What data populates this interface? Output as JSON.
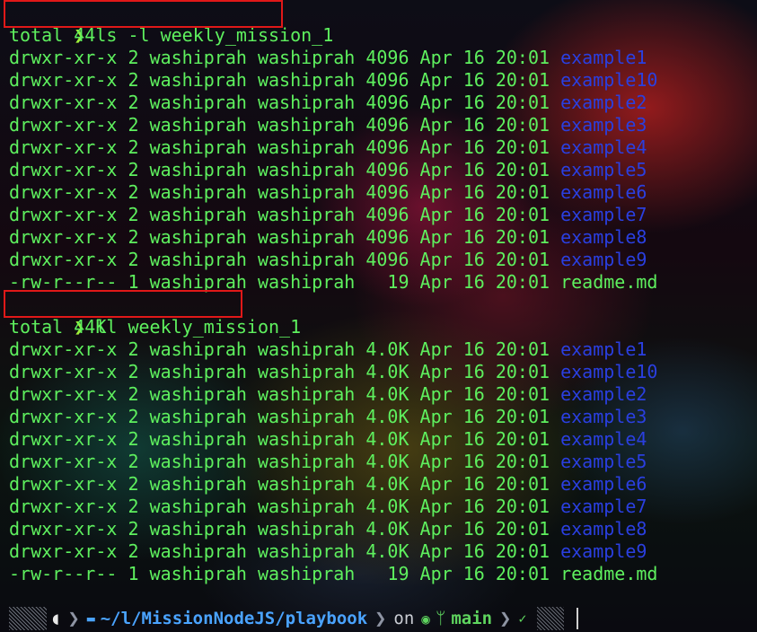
{
  "terminal": {
    "prompt_symbol": "❯",
    "command_1": "ls -l weekly_mission_1",
    "command_2": "ll weekly_mission_1",
    "total_1": "total 44",
    "total_2": "total 44K",
    "listing_1": [
      {
        "meta": "drwxr-xr-x 2 washiprah washiprah 4096 Apr 16 20:01 ",
        "name": "example1",
        "type": "dir"
      },
      {
        "meta": "drwxr-xr-x 2 washiprah washiprah 4096 Apr 16 20:01 ",
        "name": "example10",
        "type": "dir"
      },
      {
        "meta": "drwxr-xr-x 2 washiprah washiprah 4096 Apr 16 20:01 ",
        "name": "example2",
        "type": "dir"
      },
      {
        "meta": "drwxr-xr-x 2 washiprah washiprah 4096 Apr 16 20:01 ",
        "name": "example3",
        "type": "dir"
      },
      {
        "meta": "drwxr-xr-x 2 washiprah washiprah 4096 Apr 16 20:01 ",
        "name": "example4",
        "type": "dir"
      },
      {
        "meta": "drwxr-xr-x 2 washiprah washiprah 4096 Apr 16 20:01 ",
        "name": "example5",
        "type": "dir"
      },
      {
        "meta": "drwxr-xr-x 2 washiprah washiprah 4096 Apr 16 20:01 ",
        "name": "example6",
        "type": "dir"
      },
      {
        "meta": "drwxr-xr-x 2 washiprah washiprah 4096 Apr 16 20:01 ",
        "name": "example7",
        "type": "dir"
      },
      {
        "meta": "drwxr-xr-x 2 washiprah washiprah 4096 Apr 16 20:01 ",
        "name": "example8",
        "type": "dir"
      },
      {
        "meta": "drwxr-xr-x 2 washiprah washiprah 4096 Apr 16 20:01 ",
        "name": "example9",
        "type": "dir"
      },
      {
        "meta": "-rw-r--r-- 1 washiprah washiprah   19 Apr 16 20:01 ",
        "name": "readme.md",
        "type": "file"
      }
    ],
    "listing_2": [
      {
        "meta": "drwxr-xr-x 2 washiprah washiprah 4.0K Apr 16 20:01 ",
        "name": "example1",
        "type": "dir"
      },
      {
        "meta": "drwxr-xr-x 2 washiprah washiprah 4.0K Apr 16 20:01 ",
        "name": "example10",
        "type": "dir"
      },
      {
        "meta": "drwxr-xr-x 2 washiprah washiprah 4.0K Apr 16 20:01 ",
        "name": "example2",
        "type": "dir"
      },
      {
        "meta": "drwxr-xr-x 2 washiprah washiprah 4.0K Apr 16 20:01 ",
        "name": "example3",
        "type": "dir"
      },
      {
        "meta": "drwxr-xr-x 2 washiprah washiprah 4.0K Apr 16 20:01 ",
        "name": "example4",
        "type": "dir"
      },
      {
        "meta": "drwxr-xr-x 2 washiprah washiprah 4.0K Apr 16 20:01 ",
        "name": "example5",
        "type": "dir"
      },
      {
        "meta": "drwxr-xr-x 2 washiprah washiprah 4.0K Apr 16 20:01 ",
        "name": "example6",
        "type": "dir"
      },
      {
        "meta": "drwxr-xr-x 2 washiprah washiprah 4.0K Apr 16 20:01 ",
        "name": "example7",
        "type": "dir"
      },
      {
        "meta": "drwxr-xr-x 2 washiprah washiprah 4.0K Apr 16 20:01 ",
        "name": "example8",
        "type": "dir"
      },
      {
        "meta": "drwxr-xr-x 2 washiprah washiprah 4.0K Apr 16 20:01 ",
        "name": "example9",
        "type": "dir"
      },
      {
        "meta": "-rw-r--r-- 1 washiprah washiprah   19 Apr 16 20:01 ",
        "name": "readme.md",
        "type": "file"
      }
    ]
  },
  "status_bar": {
    "os_icon": "apple-icon",
    "folder_icon": "folder-icon",
    "path_prefix": "~/l/MissionNodeJS/",
    "path_current": "playbook",
    "on_label": "on",
    "git_icon": "github-icon",
    "branch_icon": "git-branch-icon",
    "branch": "main",
    "status_icon": "check-icon"
  },
  "colors": {
    "text": "#5ef05e",
    "directory": "#2a3fe0",
    "highlight_box": "#e01818",
    "path": "#4aa3ff"
  }
}
